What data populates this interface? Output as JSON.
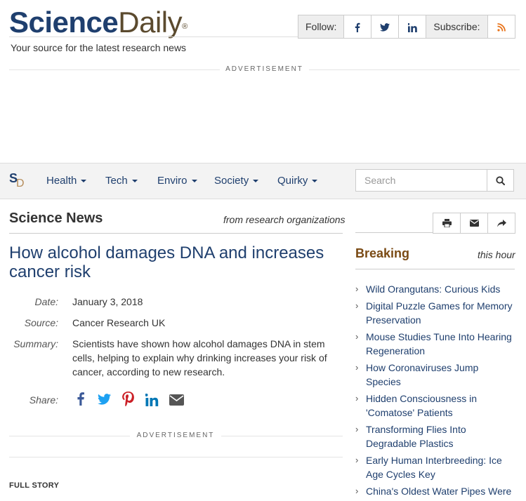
{
  "header": {
    "logo_science": "Science",
    "logo_daily": "Daily",
    "logo_reg": "®",
    "tagline": "Your source for the latest research news",
    "follow_label": "Follow:",
    "subscribe_label": "Subscribe:"
  },
  "ads": {
    "top_label": "ADVERTISEMENT",
    "mid_label": "ADVERTISEMENT"
  },
  "nav": {
    "logo_s": "S",
    "logo_d": "D",
    "items": [
      {
        "label": "Health"
      },
      {
        "label": "Tech"
      },
      {
        "label": "Enviro"
      },
      {
        "label": "Society"
      },
      {
        "label": "Quirky"
      }
    ],
    "search_placeholder": "Search"
  },
  "main": {
    "section_title": "Science News",
    "section_sub": "from research organizations",
    "headline": "How alcohol damages DNA and increases cancer risk",
    "date_label": "Date:",
    "date": "January 3, 2018",
    "source_label": "Source:",
    "source": "Cancer Research UK",
    "summary_label": "Summary:",
    "summary": "Scientists have shown how alcohol damages DNA in stem cells, helping to explain why drinking increases your risk of cancer, according to new research.",
    "share_label": "Share:",
    "full_story": "FULL STORY"
  },
  "sidebar": {
    "breaking": "Breaking",
    "this_hour": "this hour",
    "items": [
      "Wild Orangutans: Curious Kids",
      "Digital Puzzle Games for Memory Preservation",
      "Mouse Studies Tune Into Hearing Regeneration",
      "How Coronaviruses Jump Species",
      "Hidden Consciousness in 'Comatose' Patients",
      "Transforming Flies Into Degradable Plastics",
      "Early Human Interbreeding: Ice Age Cycles Key",
      "China's Oldest Water Pipes Were"
    ]
  },
  "colors": {
    "brand_blue": "#1f3f6e",
    "brand_brown": "#5b4a2e",
    "breaking_brown": "#7a4a14",
    "rss_orange": "#e8731a"
  }
}
